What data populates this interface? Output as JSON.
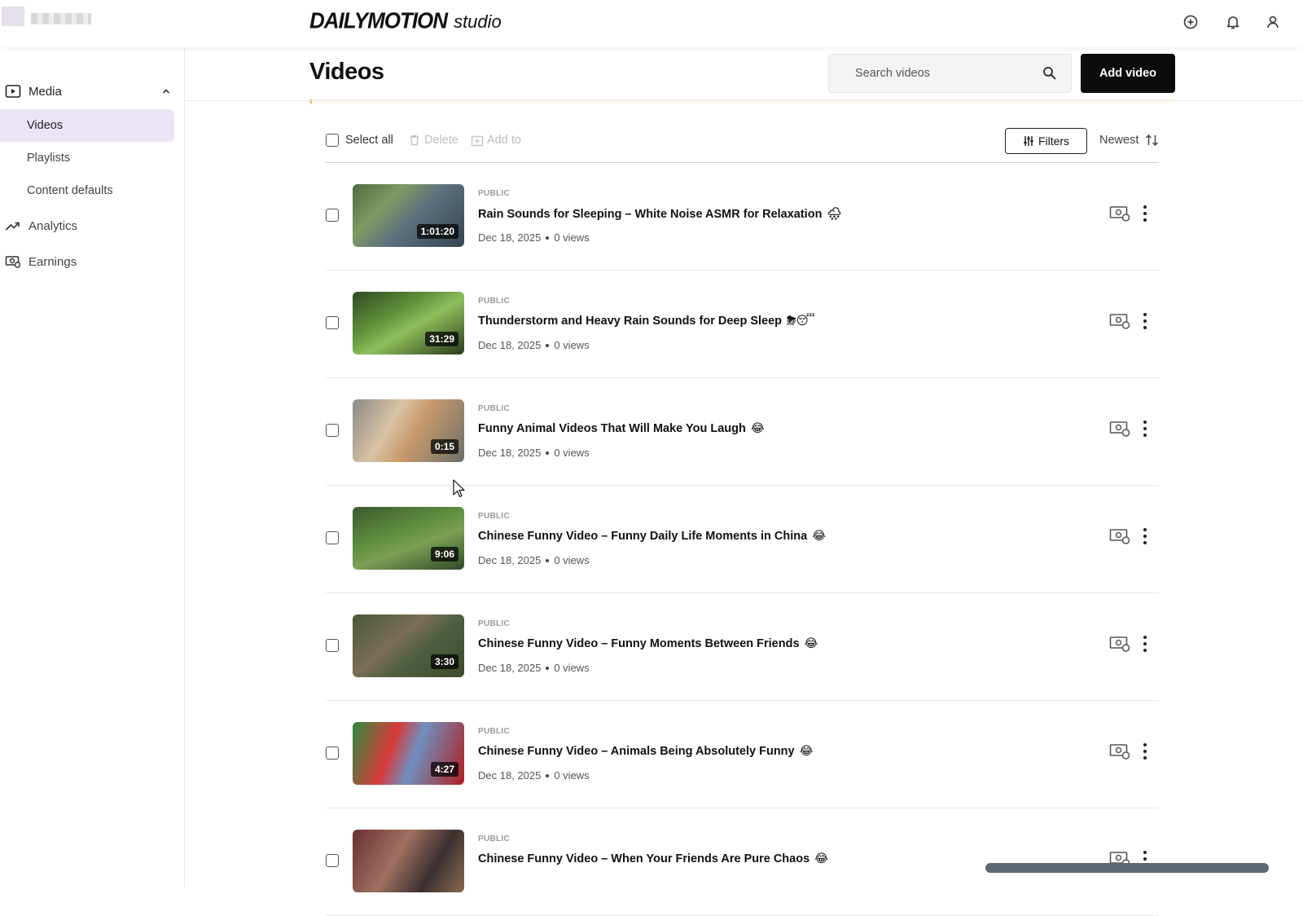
{
  "header": {
    "brand": "DAILYMOTION",
    "product": "studio",
    "icons": [
      "plus-circle-icon",
      "bell-icon",
      "user-icon"
    ]
  },
  "sidebar": {
    "media_label": "Media",
    "items": [
      {
        "label": "Videos",
        "active": true
      },
      {
        "label": "Playlists",
        "active": false
      },
      {
        "label": "Content defaults",
        "active": false
      }
    ],
    "analytics_label": "Analytics",
    "earnings_label": "Earnings"
  },
  "main": {
    "title": "Videos",
    "search_placeholder": "Search videos",
    "add_video_label": "Add video"
  },
  "toolbar": {
    "select_all": "Select all",
    "delete": "Delete",
    "add_to": "Add to",
    "filters": "Filters",
    "sort": "Newest"
  },
  "videos": [
    {
      "visibility": "PUBLIC",
      "title": "Rain Sounds for Sleeping – White Noise ASMR for Relaxation",
      "emoji": "🌧",
      "duration": "1:01:20",
      "date": "Dec 18, 2025",
      "views": "0 views"
    },
    {
      "visibility": "PUBLIC",
      "title": "Thunderstorm and Heavy Rain Sounds for Deep Sleep",
      "emoji": "⛈😴",
      "duration": "31:29",
      "date": "Dec 18, 2025",
      "views": "0 views"
    },
    {
      "visibility": "PUBLIC",
      "title": "Funny Animal Videos That Will Make You Laugh",
      "emoji": "😂",
      "duration": "0:15",
      "date": "Dec 18, 2025",
      "views": "0 views"
    },
    {
      "visibility": "PUBLIC",
      "title": "Chinese Funny Video – Funny Daily Life Moments in China",
      "emoji": "😂",
      "duration": "9:06",
      "date": "Dec 18, 2025",
      "views": "0 views"
    },
    {
      "visibility": "PUBLIC",
      "title": "Chinese Funny Video – Funny Moments Between Friends",
      "emoji": "😂",
      "duration": "3:30",
      "date": "Dec 18, 2025",
      "views": "0 views"
    },
    {
      "visibility": "PUBLIC",
      "title": "Chinese Funny Video – Animals Being Absolutely Funny",
      "emoji": "😂",
      "duration": "4:27",
      "date": "Dec 18, 2025",
      "views": "0 views"
    },
    {
      "visibility": "PUBLIC",
      "title": "Chinese Funny Video – When Your Friends Are Pure Chaos",
      "emoji": "😂",
      "duration": "",
      "date": "",
      "views": ""
    }
  ]
}
